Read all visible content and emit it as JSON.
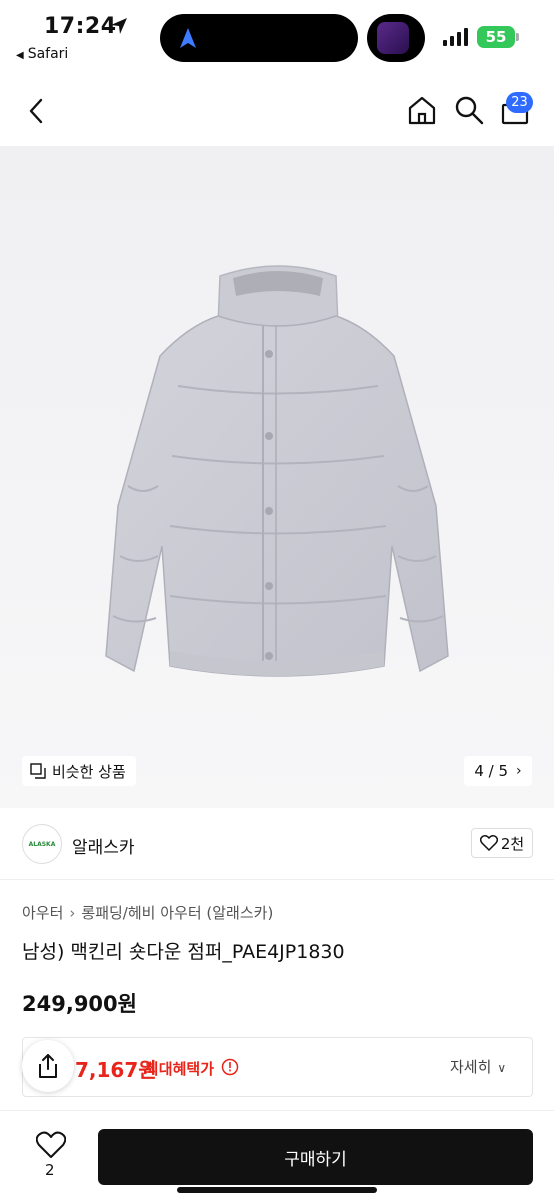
{
  "status_bar": {
    "time": "17:24",
    "back_app": "Safari",
    "battery": "55"
  },
  "header": {
    "cart_count": "23",
    "icons": [
      "chevron-left-icon",
      "home-icon",
      "search-icon",
      "shopping-bag-icon"
    ]
  },
  "gallery": {
    "similar_label": "비슷한 상품",
    "pager": "4 / 5",
    "image_subject": "light grey short down jacket"
  },
  "brand": {
    "logo_text": "ALASKA",
    "name": "알래스카",
    "likes": "2천"
  },
  "product": {
    "breadcrumb": [
      "아우터",
      "롱패딩/헤비 아우터 (알래스카)"
    ],
    "title": "남성) 맥킨리 숏다운 점퍼_PAE4JP1830",
    "price": "249,900원"
  },
  "benefit": {
    "price": "7,167원",
    "label": "최대혜택가",
    "detail": "자세히"
  },
  "bottom": {
    "heart_count": "2",
    "buy_label": "구매하기"
  },
  "colors": {
    "accent_red": "#e8251a",
    "badge_blue": "#2f6bff",
    "buy_button": "#111111",
    "battery_green": "#34c759"
  }
}
